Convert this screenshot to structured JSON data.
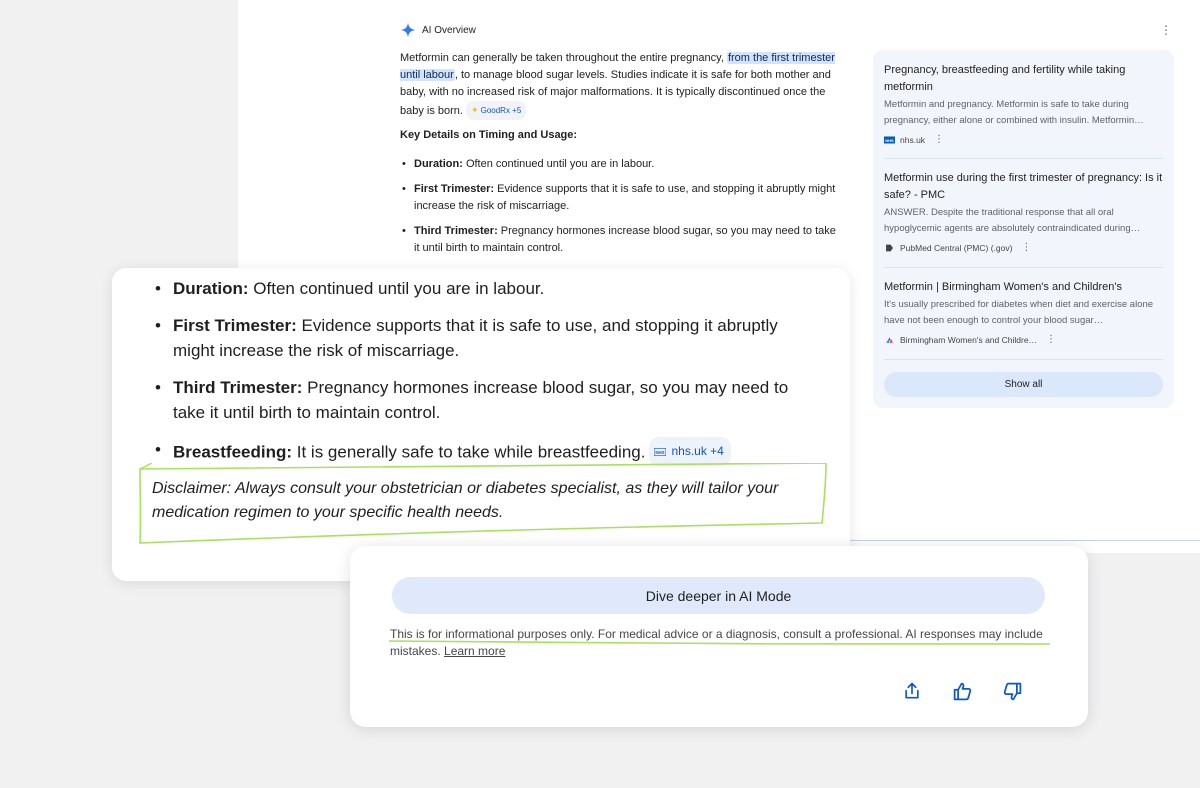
{
  "overview": {
    "title": "AI Overview",
    "para_a": "Metformin can generally be taken throughout the entire pregnancy, ",
    "para_highlight": "from the first trimester until labour",
    "para_b": ", to manage blood sugar levels. Studies indicate it is safe for both mother and baby, with no increased risk of major malformations. It is typically discontinued once the baby is born.",
    "source_chip": "GoodRx +5",
    "key_title": "Key Details on Timing and Usage:",
    "list": [
      {
        "label": "Duration:",
        "text": " Often continued until you are in labour."
      },
      {
        "label": "First Trimester:",
        "text": " Evidence supports that it is safe to use, and stopping it abruptly might increase the risk of miscarriage."
      },
      {
        "label": "Third Trimester:",
        "text": " Pregnancy hormones increase blood sugar, so you may need to take it until birth to maintain control."
      }
    ]
  },
  "sources": {
    "items": [
      {
        "title": "Pregnancy, breastfeeding and fertility while taking metformin",
        "snippet": "Metformin and pregnancy. Metformin is safe to take during pregnancy, either alone or combined with insulin. Metformin…",
        "site": "nhs.uk"
      },
      {
        "title": "Metformin use during the first trimester of pregnancy: Is it safe? - PMC",
        "snippet": "ANSWER. Despite the traditional response that all oral hypoglycemic agents are absolutely contraindicated during…",
        "site": "PubMed Central (PMC) (.gov)"
      },
      {
        "title": "Metformin | Birmingham Women's and Children's",
        "snippet": "It's usually prescribed for diabetes when diet and exercise alone have not been enough to control your blood sugar…",
        "site": "Birmingham Women's and Childre…"
      }
    ],
    "show_all": "Show all"
  },
  "zoom": {
    "list": [
      {
        "label": "Duration:",
        "text": " Often continued until you are in labour."
      },
      {
        "label": "First Trimester:",
        "text": " Evidence supports that it is safe to use, and stopping it abruptly might increase the risk of miscarriage."
      },
      {
        "label": "Third Trimester:",
        "text": " Pregnancy hormones increase blood sugar, so you may need to take it until birth to maintain control."
      },
      {
        "label": "Breastfeeding:",
        "text": " It is generally safe to take while breastfeeding."
      }
    ],
    "chip": "nhs.uk +4",
    "disclaimer": "Disclaimer: Always consult your obstetrician or diabetes specialist, as they will tailor your medication regimen to your specific health needs."
  },
  "footer": {
    "dive_button": "Dive deeper in AI Mode",
    "info_text": "This is for informational purposes only. For medical advice or a diagnosis, consult a professional. AI responses may include mistakes. ",
    "learn_more": "Learn more"
  },
  "colors": {
    "accent_blue": "#0b57d0",
    "highlight": "#d3e3fd",
    "marker_green": "#a8e05f",
    "sources_bg": "#f2f6fc"
  },
  "icons": [
    "sparkle-icon",
    "more-vert-icon",
    "nhs-logo-icon",
    "pmc-logo-icon",
    "bwc-logo-icon",
    "share-icon",
    "thumbs-up-icon",
    "thumbs-down-icon"
  ]
}
